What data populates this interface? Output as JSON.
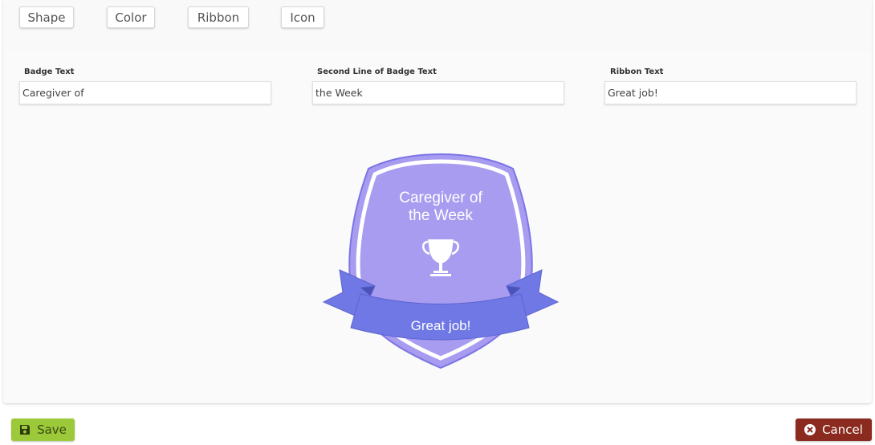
{
  "tabs": [
    {
      "label": "Shape"
    },
    {
      "label": "Color"
    },
    {
      "label": "Ribbon"
    },
    {
      "label": "Icon"
    }
  ],
  "fields": {
    "badge_text": {
      "label": "Badge Text",
      "value": "Caregiver of"
    },
    "second_line": {
      "label": "Second Line of Badge Text",
      "value": "the Week"
    },
    "ribbon_text": {
      "label": "Ribbon Text",
      "value": "Great job!"
    }
  },
  "badge": {
    "line1": "Caregiver of",
    "line2": "the Week",
    "ribbon": "Great job!",
    "icon": "trophy-icon",
    "shield_color": "#a89cf0",
    "outline_color": "#7c74e6",
    "ribbon_color": "#6f78e4"
  },
  "footer": {
    "save_label": "Save",
    "save_icon": "floppy-disk-icon",
    "cancel_label": "Cancel",
    "cancel_icon": "close-circle-icon"
  },
  "colors": {
    "save": "#9bc93a",
    "cancel": "#8b2a1e"
  }
}
